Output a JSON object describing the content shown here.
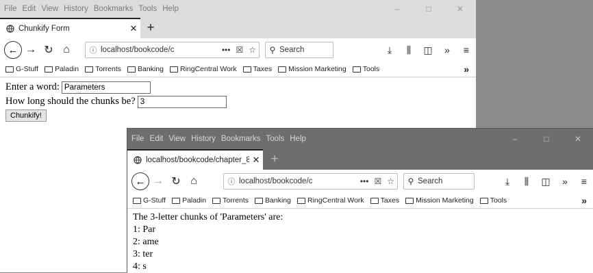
{
  "window1": {
    "menu": [
      "File",
      "Edit",
      "View",
      "History",
      "Bookmarks",
      "Tools",
      "Help"
    ],
    "win_controls": [
      "–",
      "□",
      "✕"
    ],
    "tab_title": "Chunkify Form",
    "tab_close": "✕",
    "new_tab": "+",
    "url": "localhost/bookcode/c",
    "search_placeholder": "Search",
    "bookmarks": [
      "G-Stuff",
      "Paladin",
      "Torrents",
      "Banking",
      "RingCentral Work",
      "Taxes",
      "Mission Marketing",
      "Tools"
    ],
    "bookmarks_more": "»",
    "form": {
      "word_label": "Enter a word:",
      "word_value": "Parameters",
      "chunk_label": "How long should the chunks be?",
      "chunk_value": "3",
      "submit_label": "Chunkify!"
    }
  },
  "window2": {
    "menu": [
      "File",
      "Edit",
      "View",
      "History",
      "Bookmarks",
      "Tools",
      "Help"
    ],
    "win_controls": [
      "–",
      "□",
      "✕"
    ],
    "tab_title": "localhost/bookcode/chapter_8",
    "tab_close": "✕",
    "new_tab": "+",
    "url": "localhost/bookcode/c",
    "search_placeholder": "Search",
    "bookmarks": [
      "G-Stuff",
      "Paladin",
      "Torrents",
      "Banking",
      "RingCentral Work",
      "Taxes",
      "Mission Marketing",
      "Tools"
    ],
    "bookmarks_more": "»",
    "result": {
      "heading": "The 3-letter chunks of 'Parameters' are:",
      "lines": [
        "1: Par",
        "2: ame",
        "3: ter",
        "4: s"
      ]
    }
  },
  "icons": {
    "back": "back-arrow-icon",
    "forward": "forward-arrow-icon",
    "reload": "reload-icon",
    "home": "home-icon",
    "info": "info-icon",
    "page_actions": "more-icon",
    "pocket": "pocket-icon",
    "bookmark_star": "star-icon",
    "search": "search-icon",
    "download": "download-icon",
    "library": "library-icon",
    "sidebar": "sidebar-icon",
    "overflow": "overflow-icon",
    "menu": "hamburger-icon"
  }
}
